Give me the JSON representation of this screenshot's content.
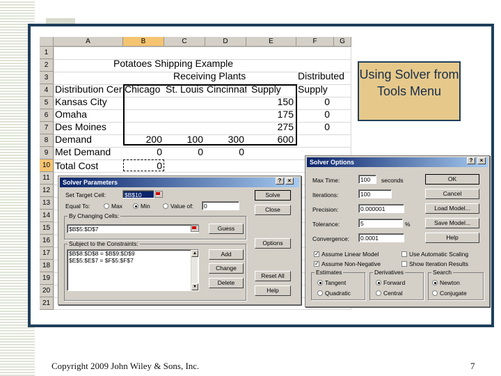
{
  "callout_text": "Using Solver from Tools Menu",
  "footer": {
    "copyright": "Copyright 2009 John Wiley & Sons, Inc.",
    "page_number": "7"
  },
  "sheet": {
    "columns": [
      "A",
      "B",
      "C",
      "D",
      "E",
      "F",
      "G"
    ],
    "rows": [
      "1",
      "2",
      "3",
      "4",
      "5",
      "6",
      "7",
      "8",
      "9",
      "10",
      "11",
      "12",
      "13",
      "14",
      "15",
      "16",
      "17",
      "18",
      "19",
      "20",
      "21"
    ],
    "title": "Potatoes Shipping Example",
    "receiving_plants": "Receiving Plants",
    "distributed": "Distributed",
    "header_row": [
      "Distribution Cen",
      "Chicago",
      "St. Louis",
      "Cincinnati",
      "Supply",
      "Supply"
    ],
    "body": [
      {
        "label": "Kansas City",
        "supply": "150",
        "dist": "0"
      },
      {
        "label": "Omaha",
        "supply": "175",
        "dist": "0"
      },
      {
        "label": "Des Moines",
        "supply": "275",
        "dist": "0"
      }
    ],
    "demand": {
      "label": "Demand",
      "vals": [
        "200",
        "100",
        "300",
        "600"
      ]
    },
    "met_demand": {
      "label": "Met Demand",
      "vals": [
        "0",
        "0",
        "0"
      ]
    },
    "total_cost": {
      "label": "Total Cost",
      "val": "0"
    }
  },
  "solver_params": {
    "title": "Solver Parameters",
    "set_target_label": "Set Target Cell:",
    "set_target_value": "$B$10",
    "equal_to_label": "Equal To:",
    "max_label": "Max",
    "min_label": "Min",
    "value_of_label": "Value of:",
    "value_of_value": "0",
    "changing_label": "By Changing Cells:",
    "changing_value": "$B$5:$D$7",
    "guess": "Guess",
    "constraints_label": "Subject to the Constraints:",
    "constraints": [
      "$B$8:$D$8 = $B$9:$D$9",
      "$E$5:$E$7 = $F$5:$F$7"
    ],
    "buttons": {
      "solve": "Solve",
      "close": "Close",
      "options": "Options",
      "add": "Add",
      "change": "Change",
      "delete": "Delete",
      "reset": "Reset All",
      "help": "Help"
    }
  },
  "solver_options": {
    "title": "Solver Options",
    "max_time_label": "Max Time:",
    "max_time_value": "100",
    "seconds": "seconds",
    "iterations_label": "Iterations:",
    "iterations_value": "100",
    "precision_label": "Precision:",
    "precision_value": "0.000001",
    "tolerance_label": "Tolerance:",
    "tolerance_value": "5",
    "percent": "%",
    "convergence_label": "Convergence:",
    "convergence_value": "0.0001",
    "assume_linear": "Assume Linear Model",
    "assume_nonneg": "Assume Non-Negative",
    "auto_scaling": "Use Automatic Scaling",
    "show_iter": "Show Iteration Results",
    "estimates": {
      "title": "Estimates",
      "a": "Tangent",
      "b": "Quadratic"
    },
    "derivatives": {
      "title": "Derivatives",
      "a": "Forward",
      "b": "Central"
    },
    "search": {
      "title": "Search",
      "a": "Newton",
      "b": "Conjugate"
    },
    "buttons": {
      "ok": "OK",
      "cancel": "Cancel",
      "load": "Load Model...",
      "save": "Save Model...",
      "help": "Help"
    }
  },
  "title_buttons": {
    "help": "?",
    "close": "×"
  }
}
